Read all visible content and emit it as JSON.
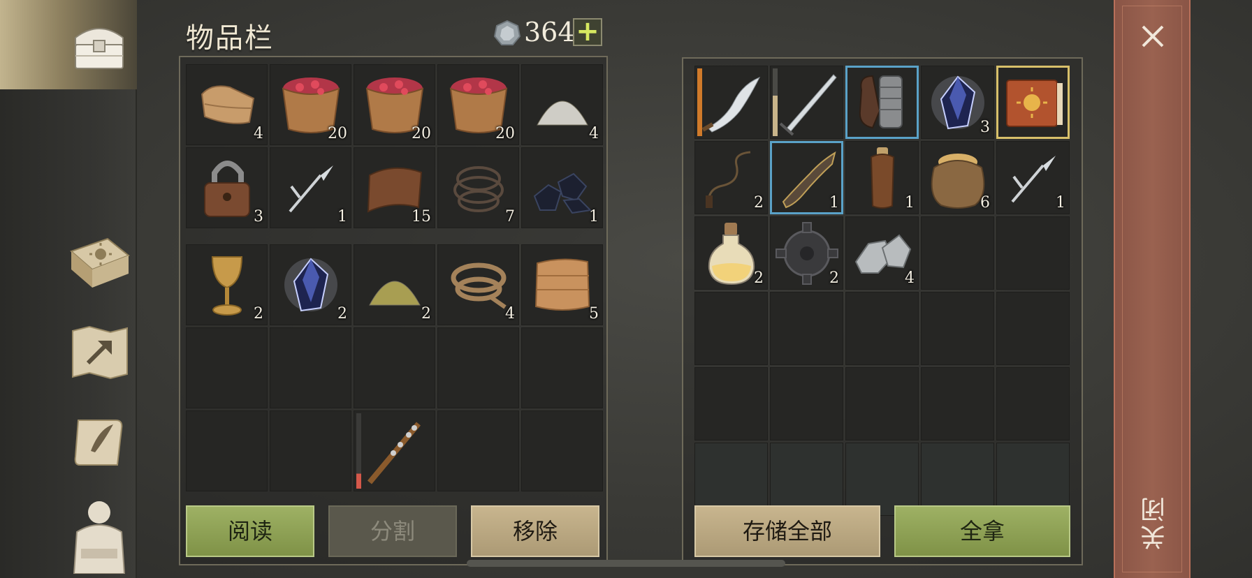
{
  "inventory": {
    "title": "物品栏",
    "coins": "364",
    "add_label": "+",
    "slots_top": [
      {
        "icon": "cloth-icon",
        "qty": "4"
      },
      {
        "icon": "berry-bucket-icon",
        "qty": "20"
      },
      {
        "icon": "berry-bucket-icon",
        "qty": "20"
      },
      {
        "icon": "berry-bucket-icon",
        "qty": "20"
      },
      {
        "icon": "salt-pile-icon",
        "qty": "4"
      },
      {
        "icon": "padlock-icon",
        "qty": "3"
      },
      {
        "icon": "hook-fork-icon",
        "qty": "1"
      },
      {
        "icon": "leather-icon",
        "qty": "15"
      },
      {
        "icon": "wire-coil-icon",
        "qty": "7"
      },
      {
        "icon": "coal-icon",
        "qty": "1"
      }
    ],
    "slots_bottom": [
      {
        "icon": "goblet-icon",
        "qty": "2"
      },
      {
        "icon": "crystal-icon",
        "qty": "2"
      },
      {
        "icon": "sulfur-pile-icon",
        "qty": "2"
      },
      {
        "icon": "rope-icon",
        "qty": "4"
      },
      {
        "icon": "burlap-icon",
        "qty": "5"
      },
      {
        "icon": "",
        "qty": ""
      },
      {
        "icon": "",
        "qty": ""
      },
      {
        "icon": "",
        "qty": ""
      },
      {
        "icon": "",
        "qty": ""
      },
      {
        "icon": "",
        "qty": ""
      },
      {
        "icon": "",
        "qty": ""
      },
      {
        "icon": "",
        "qty": ""
      },
      {
        "icon": "spiked-club-icon",
        "qty": ""
      },
      {
        "icon": "",
        "qty": ""
      },
      {
        "icon": "",
        "qty": ""
      }
    ],
    "buttons": {
      "read": "阅读",
      "split": "分割",
      "remove": "移除"
    }
  },
  "storage": {
    "slots": [
      {
        "icon": "scimitar-icon",
        "qty": ""
      },
      {
        "icon": "longsword-icon",
        "qty": ""
      },
      {
        "icon": "gauntlet-icon",
        "qty": ""
      },
      {
        "icon": "crystal-icon",
        "qty": "3"
      },
      {
        "icon": "sun-book-icon",
        "qty": ""
      },
      {
        "icon": "whip-icon",
        "qty": "2"
      },
      {
        "icon": "crossbow-stock-icon",
        "qty": "1"
      },
      {
        "icon": "leather-bottle-icon",
        "qty": "1"
      },
      {
        "icon": "grain-sack-icon",
        "qty": "6"
      },
      {
        "icon": "hook-fork-icon",
        "qty": "1"
      },
      {
        "icon": "potion-icon",
        "qty": "2"
      },
      {
        "icon": "gear-icon",
        "qty": "2"
      },
      {
        "icon": "iron-ore-icon",
        "qty": "4"
      }
    ],
    "buttons": {
      "store_all": "存储全部",
      "take_all": "全拿"
    }
  },
  "close": {
    "label": "关闭"
  },
  "colors": {
    "accent_green": "#8fa354",
    "close_red": "#9a6250",
    "tan": "#c0ad87"
  }
}
